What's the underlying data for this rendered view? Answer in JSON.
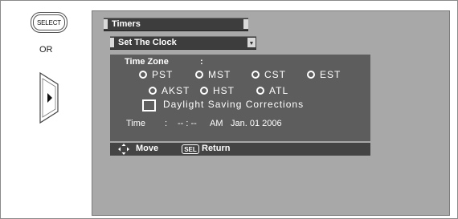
{
  "remote": {
    "select_label": "SELECT",
    "or_label": "OR"
  },
  "menu": {
    "level1": "Timers",
    "level2": "Set The Clock"
  },
  "time_zone": {
    "label": "Time Zone",
    "colon": ":",
    "selected": "HST",
    "options": [
      "PST",
      "MST",
      "CST",
      "EST",
      "AKST",
      "HST",
      "ATL"
    ]
  },
  "daylight": {
    "label": "Daylight Saving Corrections",
    "checked": false
  },
  "time": {
    "label": "Time",
    "colon": ":",
    "value": "-- : --",
    "ampm": "AM",
    "date": "Jan. 01 2006"
  },
  "footer": {
    "move_label": "Move",
    "sel_badge": "SEL",
    "return_label": "Return"
  },
  "colors": {
    "screen_bg": "#a8a8a8",
    "panel_bg": "#5d5d5d",
    "bar_bg": "#3d3d3d",
    "footer_bg": "#444444"
  }
}
